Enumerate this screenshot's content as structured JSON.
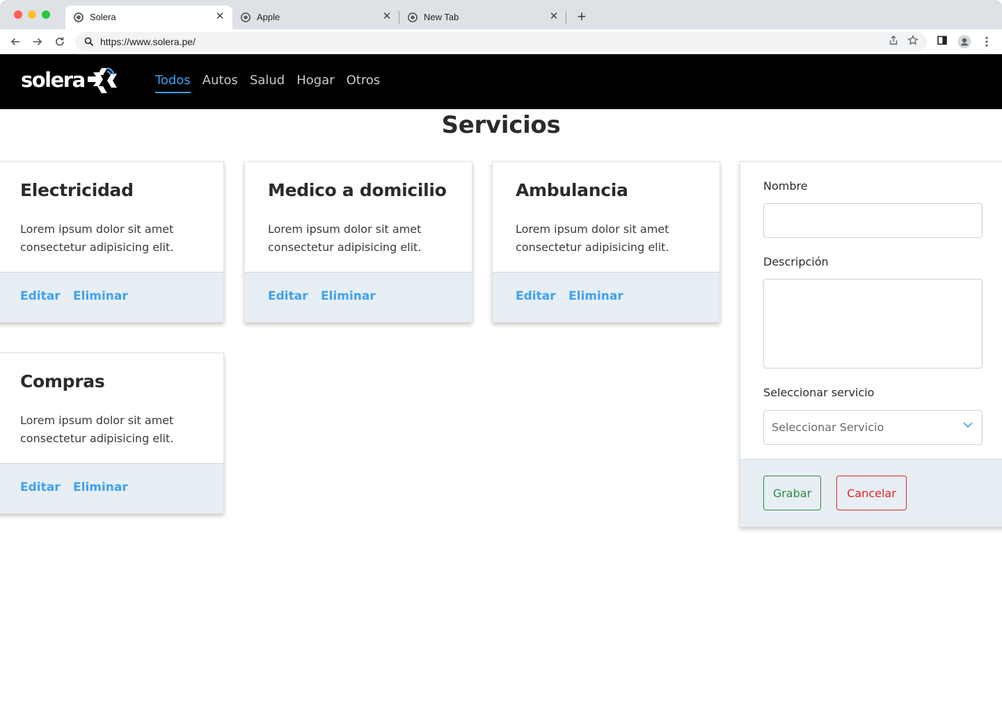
{
  "browser": {
    "tabs": [
      {
        "title": "Solera",
        "active": true
      },
      {
        "title": "Apple",
        "active": false
      },
      {
        "title": "New Tab",
        "active": false
      }
    ],
    "url": "https://www.solera.pe/"
  },
  "site": {
    "logo_text": "solera",
    "nav": [
      {
        "label": "Todos",
        "active": true
      },
      {
        "label": "Autos",
        "active": false
      },
      {
        "label": "Salud",
        "active": false
      },
      {
        "label": "Hogar",
        "active": false
      },
      {
        "label": "Otros",
        "active": false
      }
    ]
  },
  "main": {
    "title": "Servicios",
    "cards": [
      {
        "title": "Electricidad",
        "text": "Lorem ipsum dolor sit amet consectetur adipisicing elit.",
        "edit_label": "Editar",
        "delete_label": "Eliminar"
      },
      {
        "title": "Medico a domicilio",
        "text": "Lorem ipsum dolor sit amet consectetur adipisicing elit.",
        "edit_label": "Editar",
        "delete_label": "Eliminar"
      },
      {
        "title": "Ambulancia",
        "text": "Lorem ipsum dolor sit amet consectetur adipisicing elit.",
        "edit_label": "Editar",
        "delete_label": "Eliminar"
      },
      {
        "title": "Compras",
        "text": "Lorem ipsum dolor sit amet consectetur adipisicing elit.",
        "edit_label": "Editar",
        "delete_label": "Eliminar"
      }
    ]
  },
  "form": {
    "name_label": "Nombre",
    "name_value": "",
    "description_label": "Descripción",
    "description_value": "",
    "service_label": "Seleccionar servicio",
    "service_selected": "Seleccionar Servicio",
    "save_label": "Grabar",
    "cancel_label": "Cancelar"
  },
  "colors": {
    "accent": "#3ea1f0",
    "navbar_bg": "#000000",
    "footer_bg": "#e7eef4",
    "save": "#2e8b47",
    "cancel": "#e02424"
  },
  "icons": [
    "back-icon",
    "forward-icon",
    "reload-icon",
    "search-icon",
    "share-icon",
    "bookmark-star-icon",
    "side-panel-icon",
    "profile-icon",
    "menu-icon",
    "chevron-down-icon"
  ]
}
